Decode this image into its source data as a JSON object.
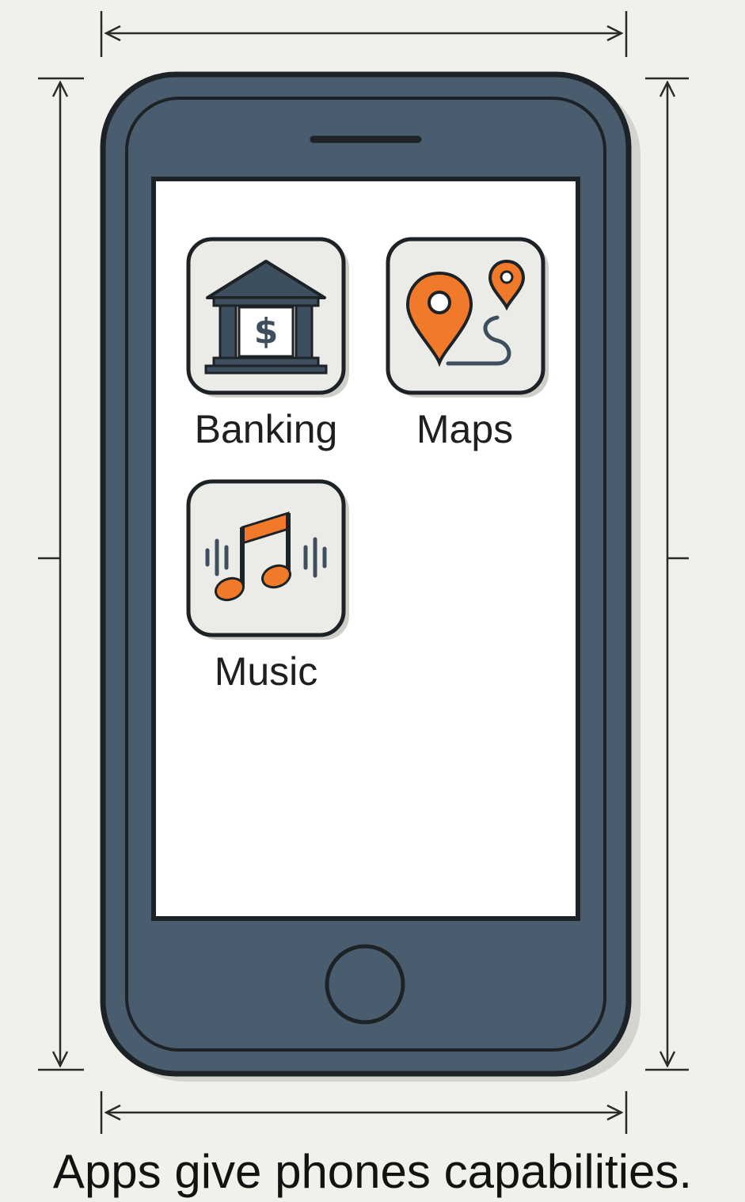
{
  "apps": [
    {
      "label": "Banking",
      "icon": "bank-icon"
    },
    {
      "label": "Maps",
      "icon": "map-pin-icon"
    },
    {
      "label": "Music",
      "icon": "music-note-icon"
    }
  ],
  "caption": "Apps give phones capabilities.",
  "colors": {
    "background": "#f1f1ec",
    "phone_body": "#4a5d6e",
    "outline": "#1d2226",
    "screen": "#ffffff",
    "icon_tile": "#ebebe7",
    "accent": "#f07a2a",
    "icon_dark": "#3d4f5e"
  }
}
